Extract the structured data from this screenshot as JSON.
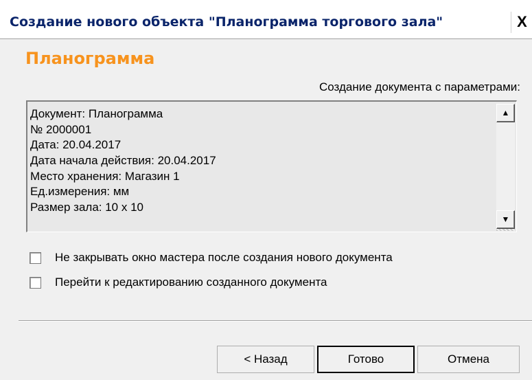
{
  "window": {
    "title": "Создание нового объекта \"Планограмма торгового зала\"",
    "close_label": "X"
  },
  "wizard": {
    "heading": "Планограмма",
    "subheading": "Создание документа с параметрами:",
    "params": [
      "Документ: Планограмма",
      "№ 2000001",
      "Дата: 20.04.2017",
      "Дата начала действия: 20.04.2017",
      "Место хранения: Магазин 1",
      "Ед.измерения: мм",
      "Размер зала: 10 x 10"
    ],
    "options": [
      {
        "label": "Не закрывать окно мастера после создания нового документа",
        "checked": false
      },
      {
        "label": "Перейти к редактированию созданного документа",
        "checked": false
      }
    ]
  },
  "buttons": {
    "back": "< Назад",
    "done": "Готово",
    "cancel": "Отмена"
  },
  "colors": {
    "heading": "#f7931e",
    "title": "#0a246a",
    "background": "#f0f0f0"
  },
  "icons": {
    "scroll_up": "scroll-up-arrow-icon",
    "scroll_down": "scroll-down-arrow-icon",
    "close": "close-icon"
  }
}
